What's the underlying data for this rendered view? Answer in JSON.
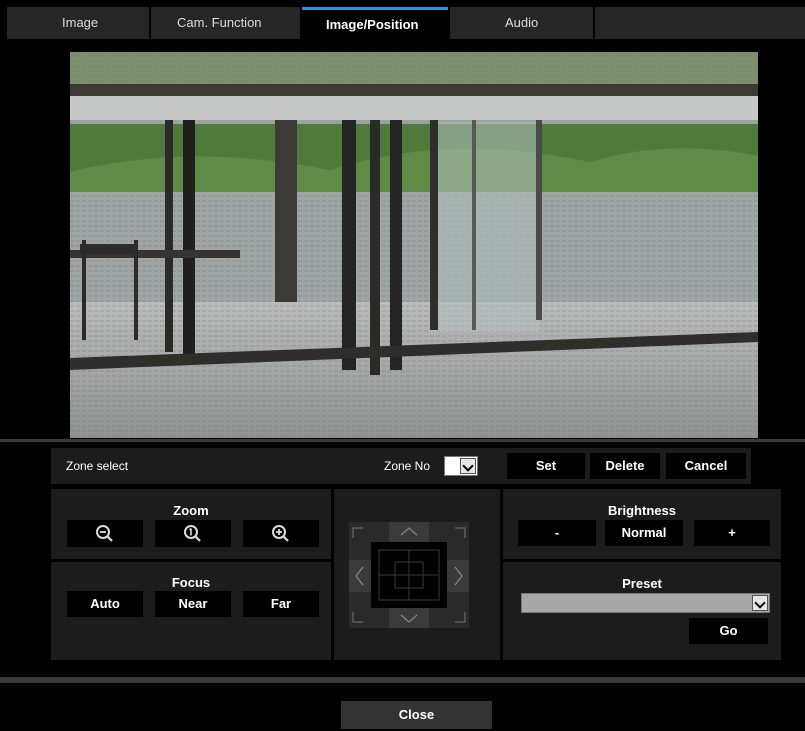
{
  "tabs": [
    {
      "label": "Image",
      "active": false
    },
    {
      "label": "Cam. Function",
      "active": false
    },
    {
      "label": "Image/Position",
      "active": true
    },
    {
      "label": "Audio",
      "active": false
    }
  ],
  "accent_color": "#2d8fd5",
  "zone": {
    "select_label": "Zone select",
    "number_label": "Zone No",
    "number_value": "",
    "set_label": "Set",
    "delete_label": "Delete",
    "cancel_label": "Cancel"
  },
  "zoom": {
    "title": "Zoom",
    "buttons": [
      "zoom-out-icon",
      "zoom-reset-icon",
      "zoom-in-icon"
    ]
  },
  "focus": {
    "title": "Focus",
    "auto_label": "Auto",
    "near_label": "Near",
    "far_label": "Far"
  },
  "brightness": {
    "title": "Brightness",
    "minus_label": "-",
    "normal_label": "Normal",
    "plus_label": "+"
  },
  "preset": {
    "title": "Preset",
    "selected": "",
    "go_label": "Go"
  },
  "pad_icons": [
    "arrow-up-icon",
    "arrow-down-icon",
    "arrow-left-icon",
    "arrow-right-icon"
  ],
  "close_label": "Close"
}
